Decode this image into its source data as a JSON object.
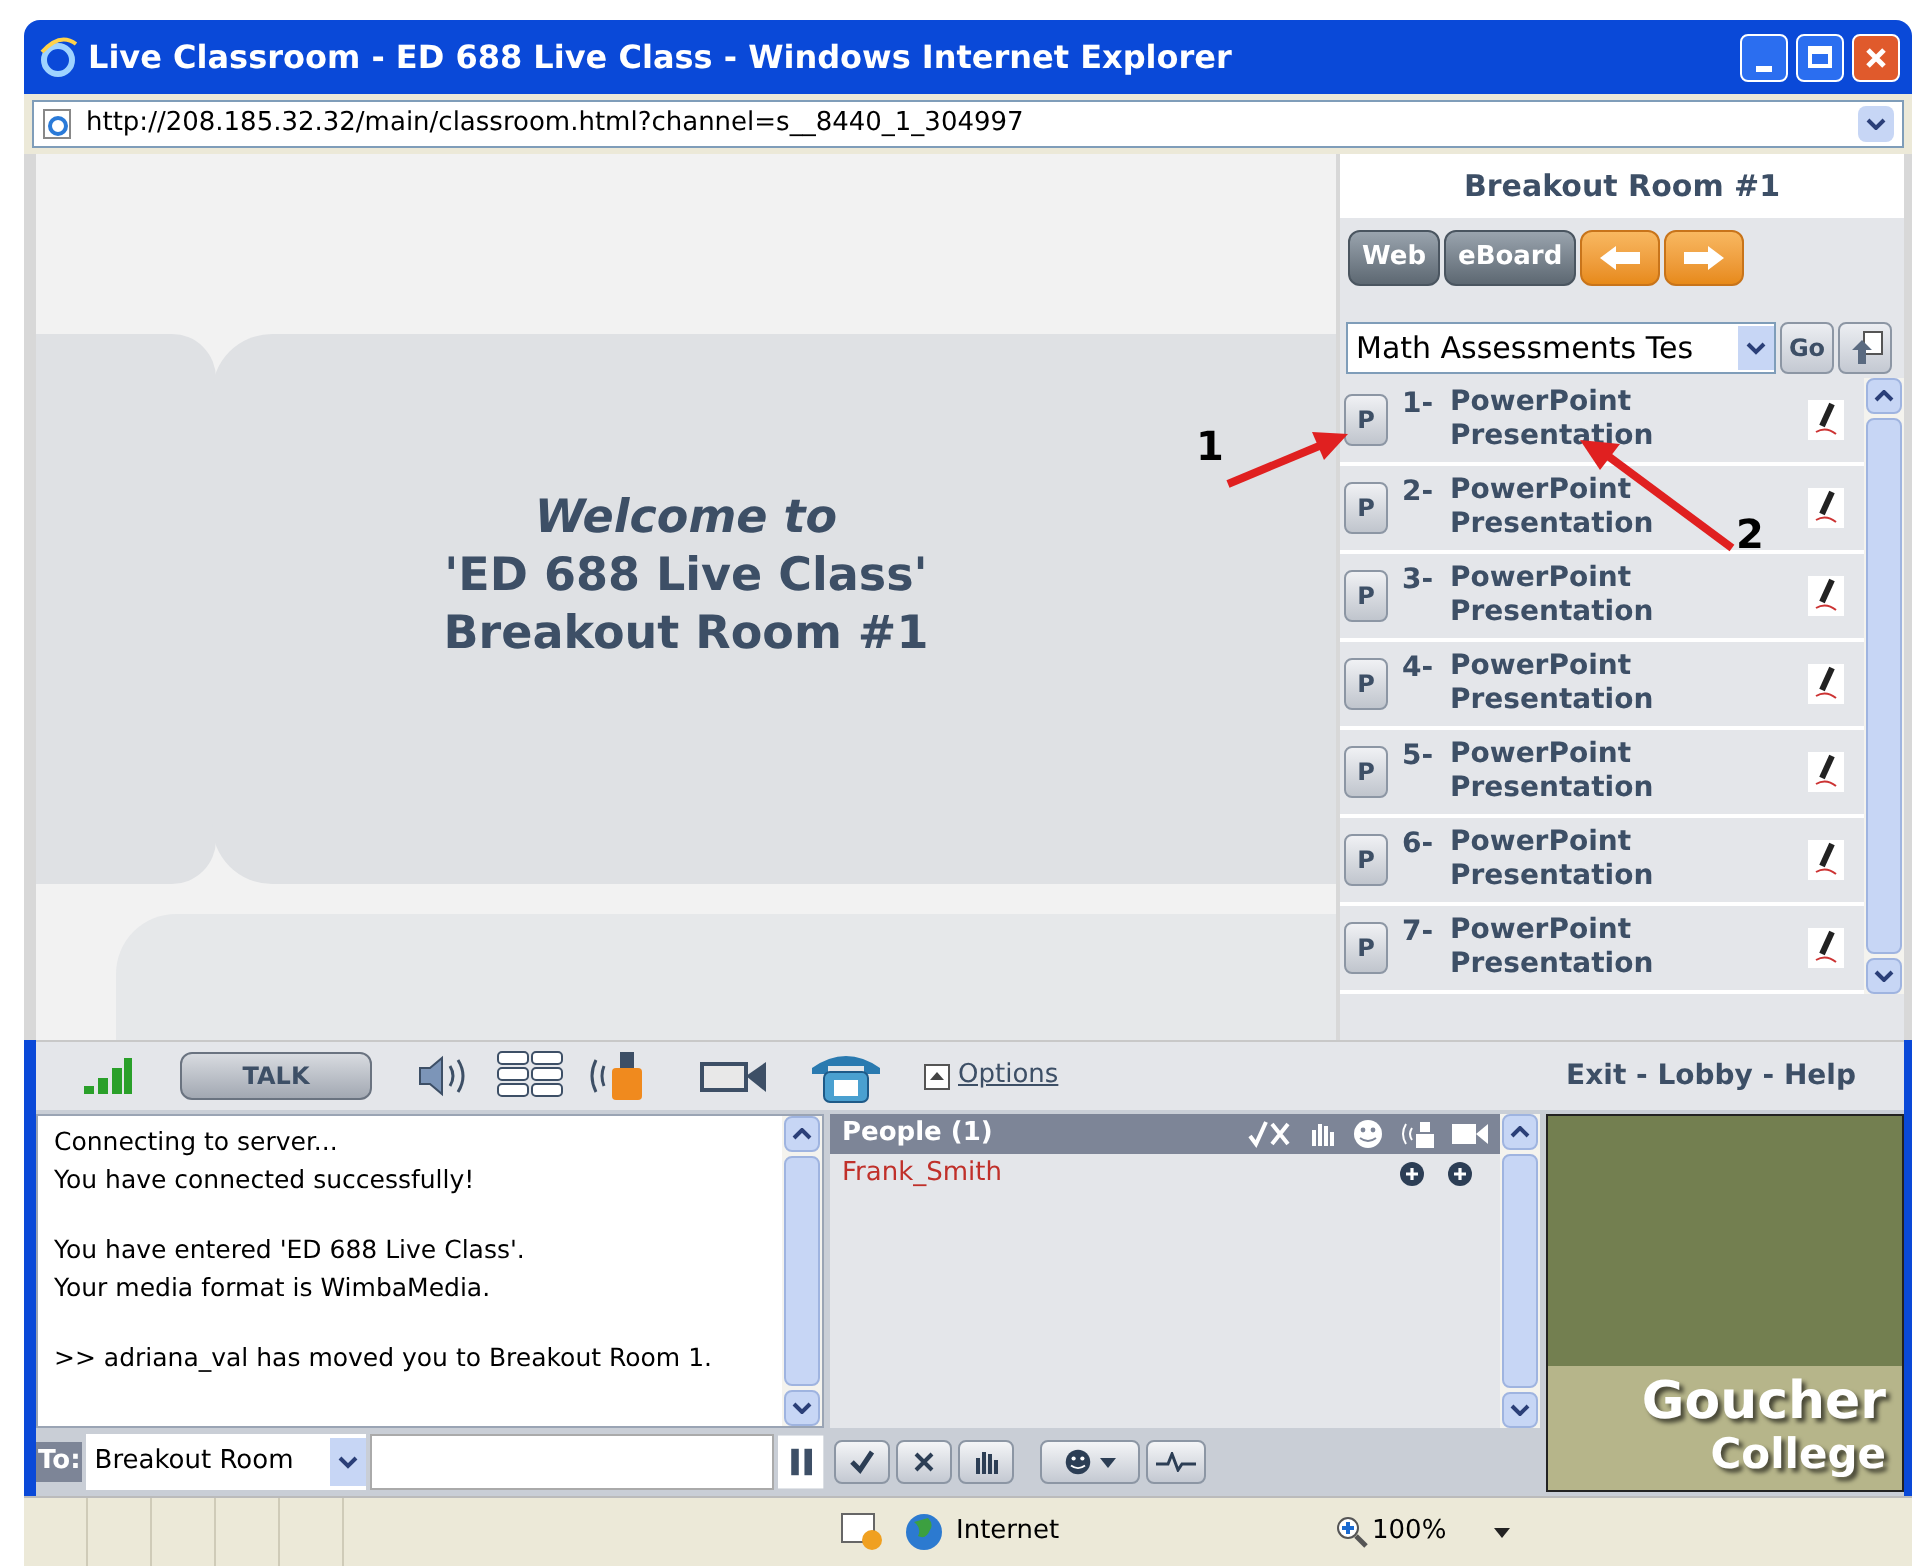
{
  "window": {
    "title": "Live Classroom - ED 688 Live Class - Windows Internet Explorer"
  },
  "address": {
    "url": "http://208.185.32.32/main/classroom.html?channel=s__8440_1_304997"
  },
  "stage": {
    "welcome": [
      "Welcome to",
      "'ED 688 Live Class'",
      "Breakout Room #1"
    ]
  },
  "room_panel": {
    "title": "Breakout Room #1",
    "buttons": [
      {
        "kind": "text",
        "label": "Web"
      },
      {
        "kind": "text",
        "label": "eBoard"
      },
      {
        "kind": "back"
      },
      {
        "kind": "forward"
      }
    ],
    "content_select": {
      "value": "Math Assessments Tes"
    },
    "go_button": "Go",
    "items": [
      {
        "badge": "P",
        "number": "1-",
        "title": [
          "PowerPoint",
          "Presentation"
        ]
      },
      {
        "badge": "P",
        "number": "2-",
        "title": [
          "PowerPoint",
          "Presentation"
        ]
      },
      {
        "badge": "P",
        "number": "3-",
        "title": [
          "PowerPoint",
          "Presentation"
        ]
      },
      {
        "badge": "P",
        "number": "4-",
        "title": [
          "PowerPoint",
          "Presentation"
        ]
      },
      {
        "badge": "P",
        "number": "5-",
        "title": [
          "PowerPoint",
          "Presentation"
        ]
      },
      {
        "badge": "P",
        "number": "6-",
        "title": [
          "PowerPoint",
          "Presentation"
        ]
      },
      {
        "badge": "P",
        "number": "7-",
        "title": [
          "PowerPoint",
          "Presentation"
        ]
      }
    ]
  },
  "annotations": [
    {
      "label": "1"
    },
    {
      "label": "2"
    }
  ],
  "toolbar": {
    "talk_button": "TALK",
    "options_link": "Options",
    "nav_links": "Exit - Lobby - Help"
  },
  "chat": {
    "messages": [
      "Connecting to server...\nYou have connected successfully!",
      "You have entered 'ED 688 Live Class'.\nYour media format is WimbaMedia.",
      ">> adriana_val has moved you to Breakout Room 1."
    ],
    "to_label": "To:",
    "recipient": "Breakout Room"
  },
  "people": {
    "header": "People (1)",
    "members": [
      {
        "name": "Frank_Smith",
        "color": "#c0302a"
      }
    ]
  },
  "logo": {
    "lines": [
      "Goucher",
      "College"
    ]
  },
  "status_bar": {
    "zone": "Internet",
    "zoom": "100%"
  }
}
